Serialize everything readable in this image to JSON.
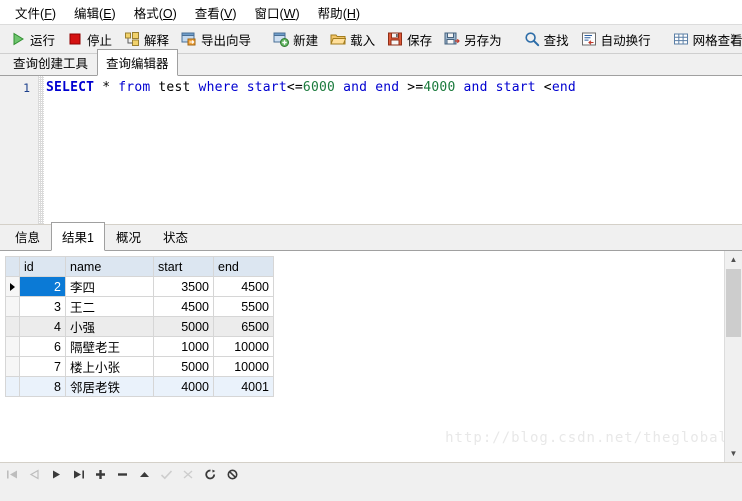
{
  "menubar": {
    "items": [
      {
        "text": "文件",
        "mnemonic": "F"
      },
      {
        "text": "编辑",
        "mnemonic": "E"
      },
      {
        "text": "格式",
        "mnemonic": "O"
      },
      {
        "text": "查看",
        "mnemonic": "V"
      },
      {
        "text": "窗口",
        "mnemonic": "W"
      },
      {
        "text": "帮助",
        "mnemonic": "H"
      }
    ]
  },
  "toolbar": {
    "run_label": "运行",
    "stop_label": "停止",
    "explain_label": "解释",
    "export_wizard_label": "导出向导",
    "new_label": "新建",
    "load_label": "载入",
    "save_label": "保存",
    "save_as_label": "另存为",
    "find_label": "查找",
    "wrap_label": "自动换行",
    "grid_view_label": "网格查看",
    "overflow_label": "»"
  },
  "top_tabs": [
    {
      "label": "查询创建工具",
      "active": false
    },
    {
      "label": "查询编辑器",
      "active": true
    }
  ],
  "editor": {
    "line_number": "1",
    "sql_tokens": [
      {
        "t": "SELECT",
        "c": "kw"
      },
      {
        "t": " * ",
        "c": "pl"
      },
      {
        "t": "from",
        "c": "kw2"
      },
      {
        "t": " test ",
        "c": "pl"
      },
      {
        "t": "where",
        "c": "kw2"
      },
      {
        "t": " ",
        "c": "pl"
      },
      {
        "t": "start",
        "c": "kw2"
      },
      {
        "t": "<=",
        "c": "op"
      },
      {
        "t": "6000",
        "c": "num"
      },
      {
        "t": " ",
        "c": "pl"
      },
      {
        "t": "and",
        "c": "kw2"
      },
      {
        "t": " ",
        "c": "pl"
      },
      {
        "t": "end",
        "c": "kw2"
      },
      {
        "t": " >=",
        "c": "op"
      },
      {
        "t": "4000",
        "c": "num"
      },
      {
        "t": " ",
        "c": "pl"
      },
      {
        "t": "and",
        "c": "kw2"
      },
      {
        "t": " ",
        "c": "pl"
      },
      {
        "t": "start",
        "c": "kw2"
      },
      {
        "t": " <",
        "c": "op"
      },
      {
        "t": "end",
        "c": "kw2"
      }
    ],
    "sql_plain": "SELECT * from test where start<=6000 and end >=4000 and start <end"
  },
  "lower_tabs": [
    {
      "label": "信息",
      "active": false
    },
    {
      "label": "结果1",
      "active": true
    },
    {
      "label": "概况",
      "active": false
    },
    {
      "label": "状态",
      "active": false
    }
  ],
  "grid": {
    "columns": [
      "id",
      "name",
      "start",
      "end"
    ],
    "rows": [
      {
        "id": "2",
        "name": "李四",
        "start": "3500",
        "end": "4500",
        "state": "selected"
      },
      {
        "id": "3",
        "name": "王二",
        "start": "4500",
        "end": "5500",
        "state": "normal"
      },
      {
        "id": "4",
        "name": "小强",
        "start": "5000",
        "end": "6500",
        "state": "alt"
      },
      {
        "id": "6",
        "name": "隔壁老王",
        "start": "1000",
        "end": "10000",
        "state": "normal"
      },
      {
        "id": "7",
        "name": "楼上小张",
        "start": "5000",
        "end": "10000",
        "state": "normal"
      },
      {
        "id": "8",
        "name": "邻居老铁",
        "start": "4000",
        "end": "4001",
        "state": "highlight"
      }
    ],
    "row_indicator": "▶"
  },
  "watermark": "http://blog.csdn.net/theglobal",
  "navbar": {
    "buttons": [
      {
        "name": "first-record",
        "glyph": "|◀",
        "enabled": false
      },
      {
        "name": "prev-record",
        "glyph": "◁",
        "enabled": false
      },
      {
        "name": "next-record",
        "glyph": "▶",
        "enabled": true
      },
      {
        "name": "last-record",
        "glyph": "▶|",
        "enabled": true
      },
      {
        "name": "add-record",
        "glyph": "✚",
        "enabled": true
      },
      {
        "name": "delete-record",
        "glyph": "▬",
        "enabled": true
      },
      {
        "name": "edit-record",
        "glyph": "▲",
        "enabled": true
      },
      {
        "name": "apply-change",
        "glyph": "✓",
        "enabled": false
      },
      {
        "name": "cancel-change",
        "glyph": "✄",
        "enabled": false
      },
      {
        "name": "refresh",
        "glyph": "↻",
        "enabled": true
      },
      {
        "name": "stop-loading",
        "glyph": "⊘",
        "enabled": true
      }
    ]
  },
  "colors": {
    "accent_selection": "#0b7ad6",
    "header_bg": "#dce6f1",
    "chrome_bg": "#f0f0f0",
    "run_green": "#3faa3f",
    "stop_red": "#d00000",
    "keyword_blue": "#0000d0",
    "number_green": "#1a7a3c"
  }
}
